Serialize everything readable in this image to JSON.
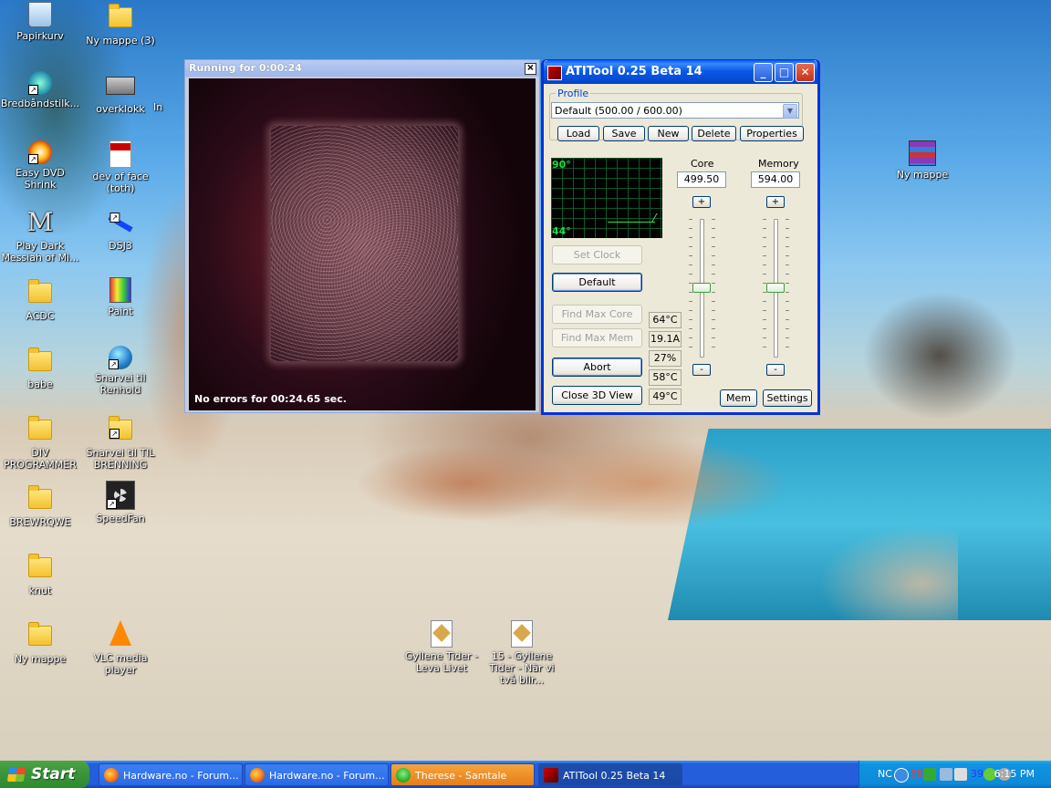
{
  "desktop_icons": [
    {
      "label": "Papirkurv",
      "icon": "recycle-bin-icon"
    },
    {
      "label": "Ny mappe (3)",
      "icon": "folder-icon"
    },
    {
      "label": "Bredbåndstilk...",
      "icon": "network-icon"
    },
    {
      "label": "overklokk",
      "icon": "chip-icon"
    },
    {
      "label": "In",
      "icon": "partial-icon"
    },
    {
      "label": "Easy DVD Shrink",
      "icon": "dvd-icon"
    },
    {
      "label": "dev of face (toth)",
      "icon": "pdf-icon"
    },
    {
      "label": "Play Dark Messiah of Mi...",
      "icon": "game-m-icon"
    },
    {
      "label": "DSJ3",
      "icon": "ski-jump-icon"
    },
    {
      "label": "ACDC",
      "icon": "folder-icon"
    },
    {
      "label": "Paint",
      "icon": "paint-icon"
    },
    {
      "label": "babe",
      "icon": "folder-icon"
    },
    {
      "label": "Snarvei til Renhold",
      "icon": "globe-icon"
    },
    {
      "label": "DIV PROGRAMMER",
      "icon": "folder-icon"
    },
    {
      "label": "Snarvei til TIL BRENNING",
      "icon": "folder-icon"
    },
    {
      "label": "BREWRQWE",
      "icon": "folder-icon"
    },
    {
      "label": "SpeedFan",
      "icon": "fan-icon"
    },
    {
      "label": "knut",
      "icon": "folder-icon"
    },
    {
      "label": "Ny mappe",
      "icon": "folder-icon"
    },
    {
      "label": "VLC media player",
      "icon": "vlc-cone-icon"
    },
    {
      "label": "Gyllene Tider - Leva Livet",
      "icon": "audio-file-icon"
    },
    {
      "label": "15 - Gyllene Tider - När vi två blir...",
      "icon": "audio-file-icon"
    },
    {
      "label": "Ny mappe",
      "icon": "winrar-archive-icon"
    }
  ],
  "view3d": {
    "title": "Running for 0:00:24",
    "status": "No errors for 00:24.65 sec."
  },
  "atitool": {
    "title": "ATITool 0.25 Beta 14",
    "profile_legend": "Profile",
    "profile_selected": "Default (500.00 / 600.00)",
    "buttons": {
      "load": "Load",
      "save": "Save",
      "new": "New",
      "delete": "Delete",
      "properties": "Properties",
      "set_clock": "Set Clock",
      "default": "Default",
      "find_max_core": "Find Max Core",
      "find_max_mem": "Find Max Mem",
      "abort": "Abort",
      "close_3d": "Close 3D View",
      "mem": "Mem",
      "settings": "Settings",
      "plus": "+",
      "minus": "-"
    },
    "graph": {
      "top_label": "90°",
      "bottom_label": "44°"
    },
    "core": {
      "label": "Core",
      "value": "499.50",
      "slider_level": 0.5
    },
    "memory": {
      "label": "Memory",
      "value": "594.00",
      "slider_level": 0.5
    },
    "readouts": [
      "64°C",
      "19.1A",
      "27%",
      "58°C",
      "49°C"
    ]
  },
  "taskbar": {
    "start": "Start",
    "tasks": [
      {
        "label": "Hardware.no - Forum...",
        "icon": "firefox-icon"
      },
      {
        "label": "Hardware.no - Forum...",
        "icon": "firefox-icon"
      },
      {
        "label": "Therese - Samtale",
        "icon": "msn-icon"
      },
      {
        "label": "ATITool 0.25 Beta 14",
        "icon": "atitool-icon"
      }
    ],
    "tray": {
      "lang": "NC",
      "temp1": "58",
      "temp2": "39",
      "clock": "6:15 PM"
    }
  }
}
